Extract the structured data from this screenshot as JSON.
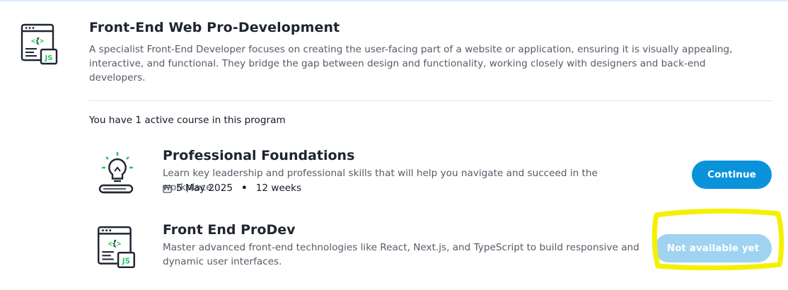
{
  "program": {
    "title": "Front-End Web Pro-Development",
    "description": "A specialist Front-End Developer focuses on creating the user-facing part of a website or application, ensuring it is visually appealing, interactive, and functional. They bridge the gap between design and functionality, working closely with designers and back-end developers.",
    "icon": "code-window-js-icon",
    "active_text": "You have 1 active course in this program"
  },
  "courses": [
    {
      "title": "Professional Foundations",
      "description": "Learn key leadership and professional skills that will help you navigate and succeed in the workplace.",
      "date": "5 May 2025",
      "separator": "•",
      "duration": "12 weeks",
      "icon": "lightbulb-book-icon",
      "button_label": "Continue"
    },
    {
      "title": "Front End ProDev",
      "description": "Master advanced front-end technologies like React, Next.js, and TypeScript to build responsive and dynamic user interfaces.",
      "icon": "code-window-js-icon",
      "button_label": "Not available yet"
    }
  ],
  "colors": {
    "primary_button": "#0a93db",
    "disabled_button": "#9fd3f1",
    "icon_accent": "#22c55e",
    "highlight": "#f5f000"
  }
}
